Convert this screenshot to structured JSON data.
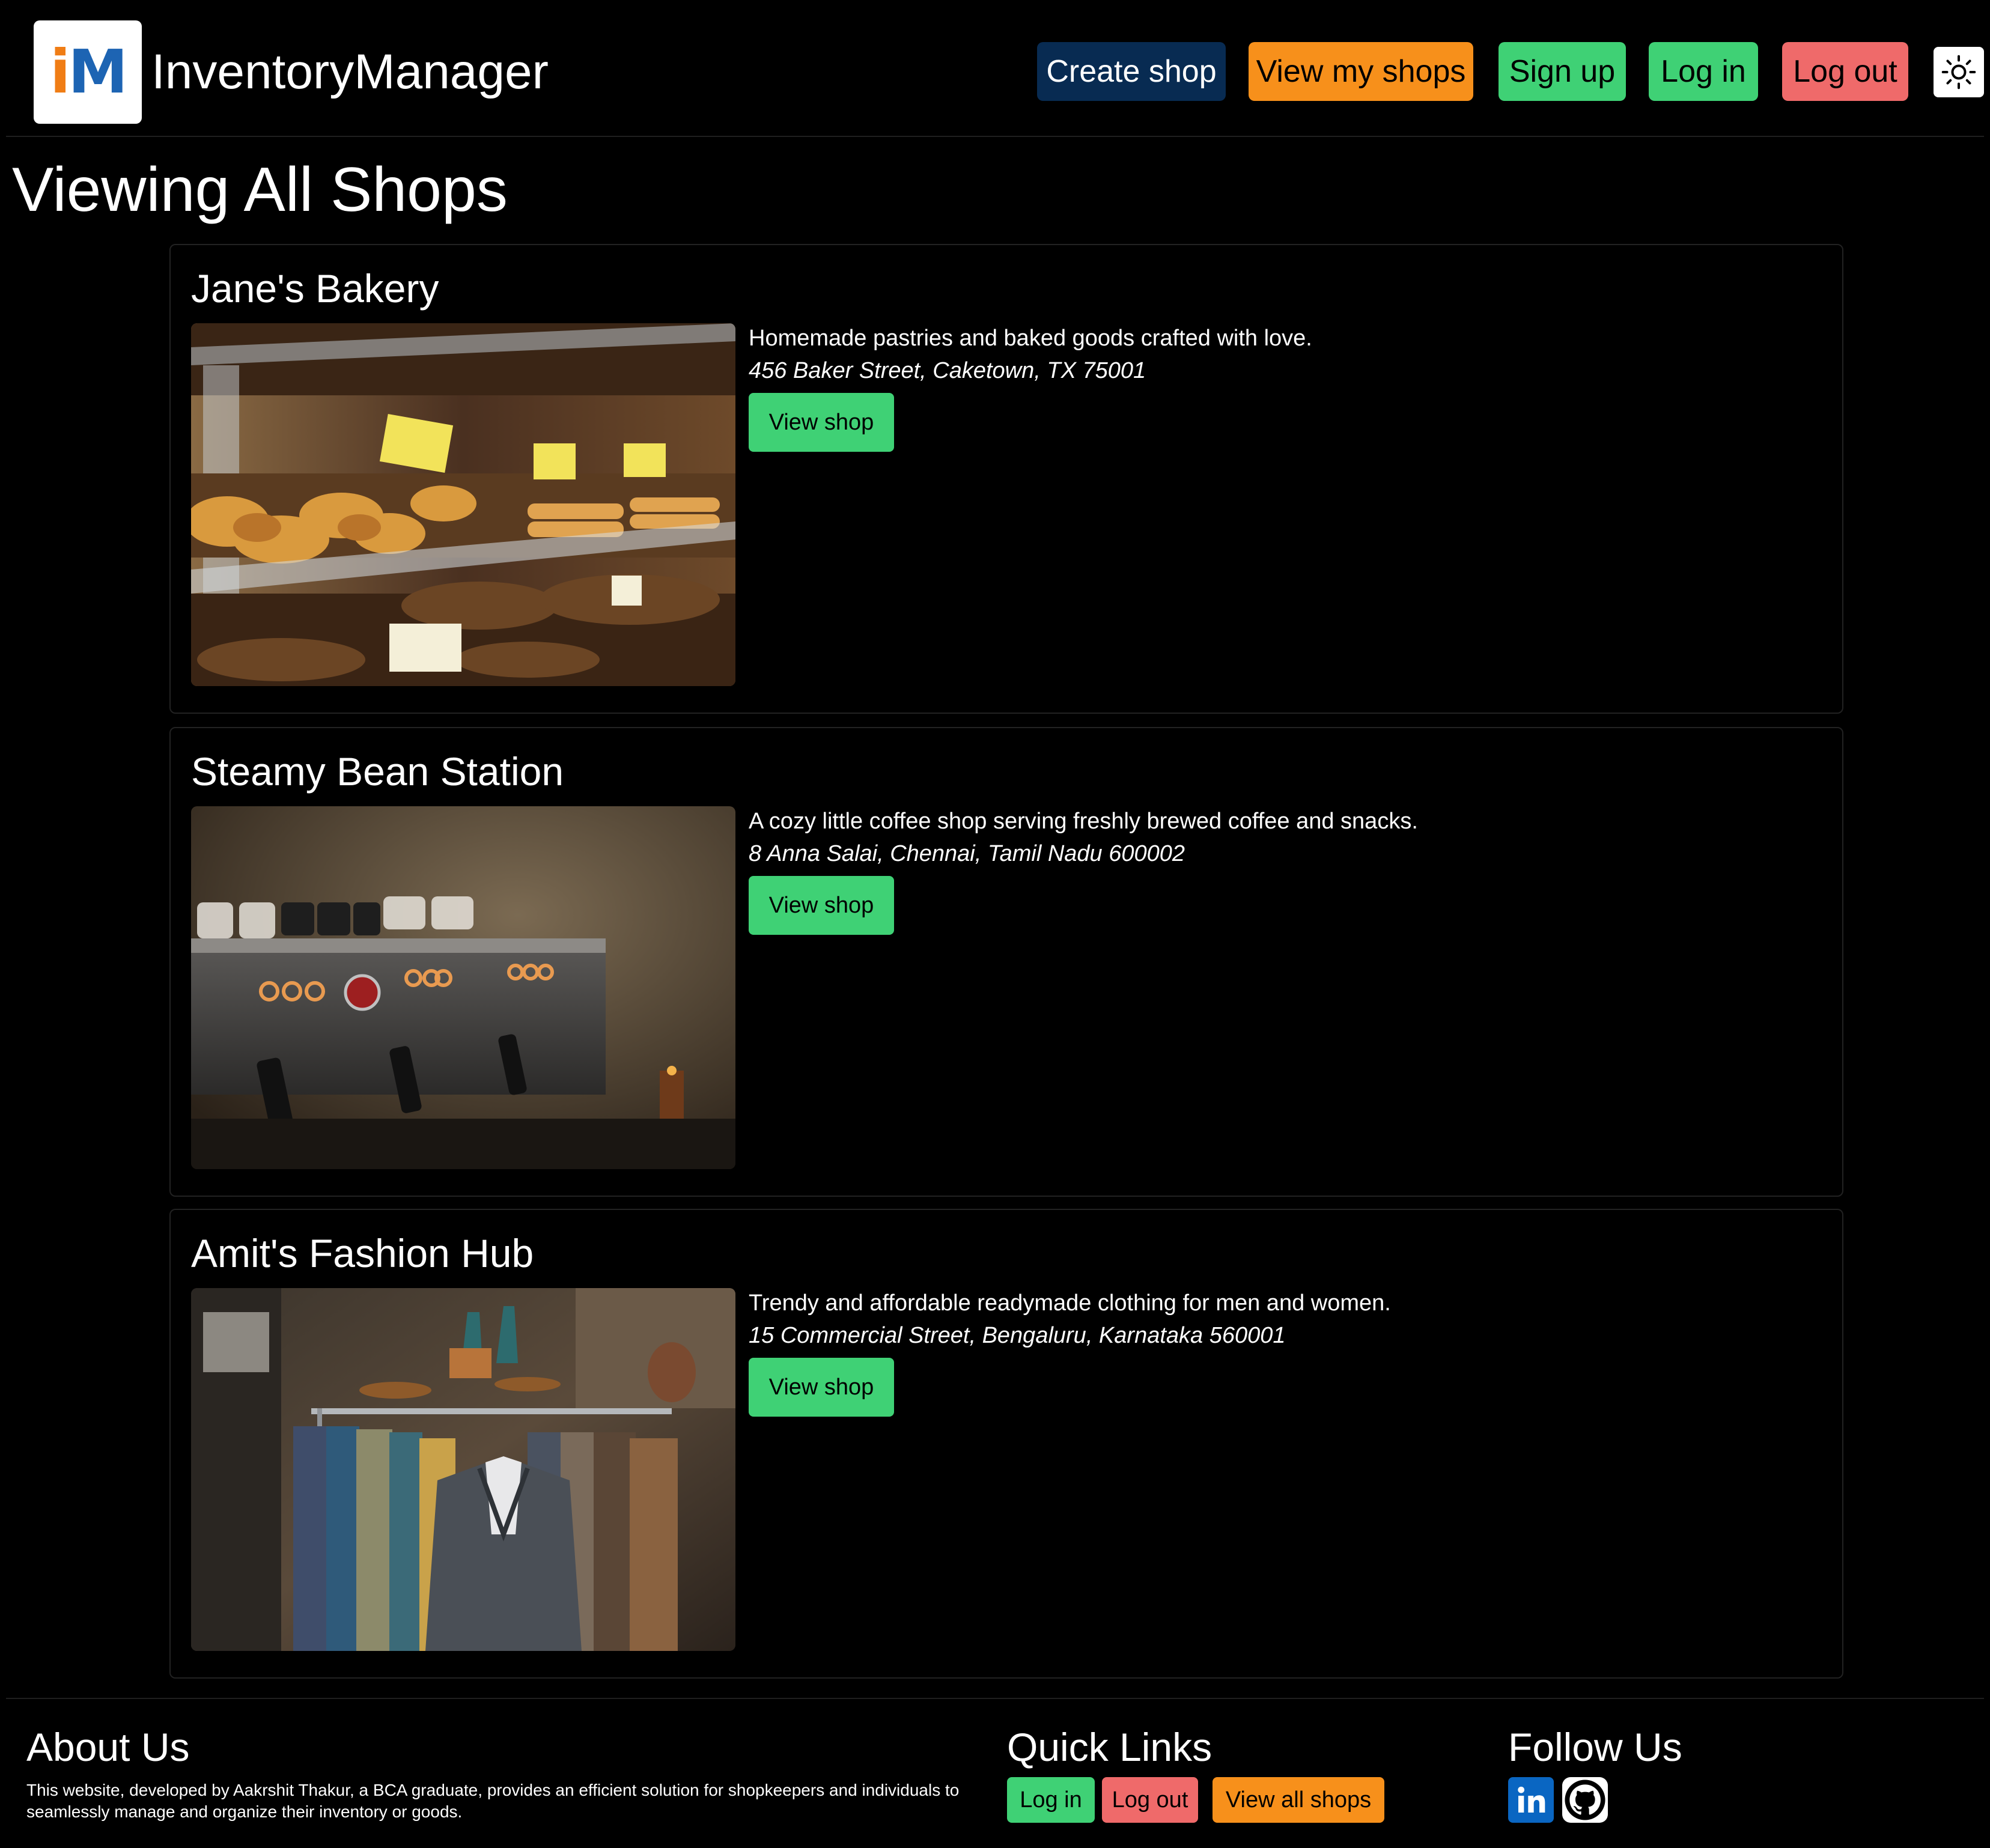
{
  "header": {
    "brand": "InventoryManager",
    "logo_i": "i",
    "logo_m": "M",
    "nav": {
      "create_shop": "Create shop",
      "view_my_shops": "View my shops",
      "sign_up": "Sign up",
      "log_in": "Log in",
      "log_out": "Log out"
    },
    "theme_icon": "sun-icon"
  },
  "main": {
    "title": "Viewing All Shops",
    "view_shop_label": "View shop",
    "shops": [
      {
        "name": "Jane's Bakery",
        "description": "Homemade pastries and baked goods crafted with love.",
        "address": "456 Baker Street, Caketown, TX 75001",
        "button": "View shop"
      },
      {
        "name": "Steamy Bean Station",
        "description": "A cozy little coffee shop serving freshly brewed coffee and snacks.",
        "address": "8 Anna Salai, Chennai, Tamil Nadu 600002",
        "button": "View shop"
      },
      {
        "name": "Amit's Fashion Hub",
        "description": "Trendy and affordable readymade clothing for men and women.",
        "address": "15 Commercial Street, Bengaluru, Karnataka 560001",
        "button": "View shop"
      }
    ]
  },
  "footer": {
    "about": {
      "heading": "About Us",
      "text": "This website, developed by Aakrshit Thakur, a BCA graduate, provides an efficient solution for shopkeepers and individuals to seamlessly manage and organize their inventory or goods."
    },
    "quick_links": {
      "heading": "Quick Links",
      "log_in": "Log in",
      "log_out": "Log out",
      "view_all_shops": "View all shops"
    },
    "follow": {
      "heading": "Follow Us",
      "icons": [
        "linkedin-icon",
        "github-icon"
      ]
    }
  },
  "colors": {
    "background": "#000000",
    "create_shop": "#082b52",
    "orange": "#f7901b",
    "green": "#3fd175",
    "red": "#ef6a6a",
    "linkedin": "#0a66c2"
  }
}
